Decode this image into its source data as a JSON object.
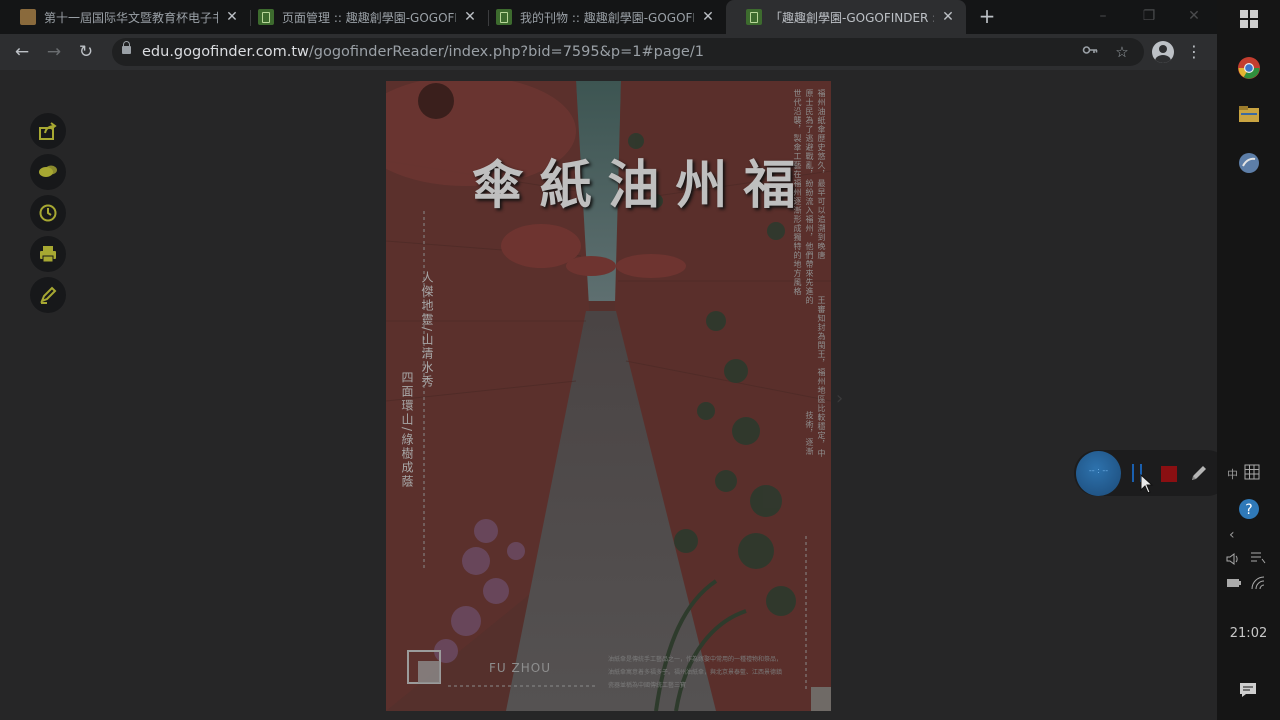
{
  "tabs": [
    {
      "title": "第十一屆国际华文暨教育杯电子书",
      "favicon": "book-icon",
      "active": false
    },
    {
      "title": "页面管理 :: 趣趣創學園-GOGOFINDER",
      "favicon": "gogofinder-icon",
      "active": false
    },
    {
      "title": "我的刊物 :: 趣趣創學園-GOGOFINDER",
      "favicon": "gogofinder-icon",
      "active": false
    },
    {
      "title": "「趣趣創學園-GOGOFINDER :: ",
      "favicon": "gogofinder-icon",
      "active": true
    }
  ],
  "address_bar": {
    "host": "edu.gogofinder.com.tw",
    "path": "/gogofinderReader/index.php?bid=7595&p=1#page/1"
  },
  "reader_tools": [
    "share-icon",
    "comment-icon",
    "history-icon",
    "print-icon",
    "draw-icon"
  ],
  "book": {
    "title_chars": [
      "福",
      "州",
      "油",
      "紙",
      "傘"
    ],
    "poem_line_1": "人傑地靈/山清水秀",
    "poem_line_2": "四面環山/綠樹成蔭",
    "intro_columns": [
      "福州油紙傘歷史悠久，最早可以追溯到晚唐",
      "王審知封為閩王，福州地區比較穩定，中",
      "原士民為了逃避戰亂，紛紛流入福州，他們帶來先進的",
      "世代沿襲，製傘工藝在福州逐漸形成獨特的地方風格",
      "技術，逐漸"
    ],
    "footer_label": "FU ZHOU",
    "footer_text": "油紙傘是傳統手工藝品之一，作為嫁娶中常用的一種禮物和祭品，油紙傘寓意着多福多子。福州油紙傘，與北京景泰藍、江西景德鎮瓷器並稱為中國傳統工藝三寶"
  },
  "recorder": {
    "timer": "-- : --",
    "pause_icon": "pause-icon",
    "stop_icon": "stop-icon",
    "pen_icon": "pen-icon"
  },
  "taskbar": {
    "clock": "21:02",
    "input_indicator": "中"
  }
}
